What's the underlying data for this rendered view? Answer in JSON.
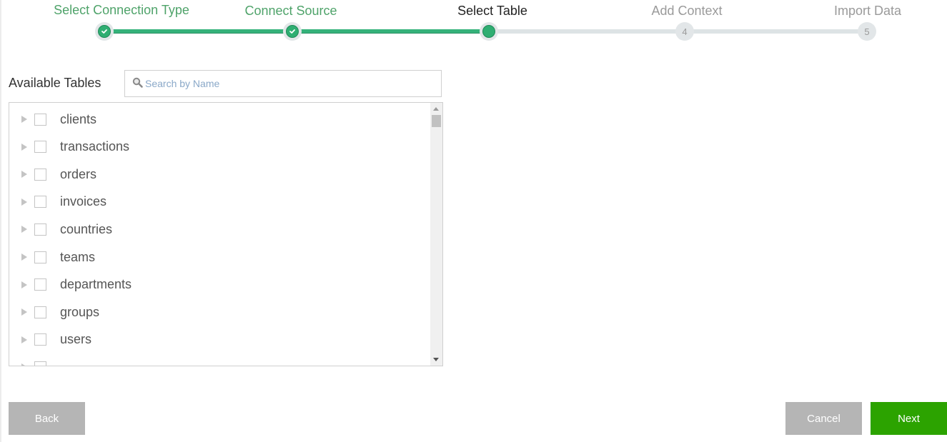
{
  "stepper": {
    "steps": [
      {
        "label": "Select Connection Type",
        "state": "done",
        "number": "1"
      },
      {
        "label": "Connect Source",
        "state": "done",
        "number": "2"
      },
      {
        "label": "Select Table",
        "state": "active",
        "number": "3"
      },
      {
        "label": "Add Context",
        "state": "todo",
        "number": "4"
      },
      {
        "label": "Import Data",
        "state": "todo",
        "number": "5"
      }
    ],
    "progress_fraction": 0.5
  },
  "tables": {
    "label": "Available Tables",
    "search_placeholder": "Search by Name",
    "search_value": "",
    "items": [
      {
        "name": "clients",
        "checked": false
      },
      {
        "name": "transactions",
        "checked": false
      },
      {
        "name": "orders",
        "checked": false
      },
      {
        "name": "invoices",
        "checked": false
      },
      {
        "name": "countries",
        "checked": false
      },
      {
        "name": "teams",
        "checked": false
      },
      {
        "name": "departments",
        "checked": false
      },
      {
        "name": "groups",
        "checked": false
      },
      {
        "name": "users",
        "checked": false
      },
      {
        "name": "",
        "checked": false
      }
    ]
  },
  "buttons": {
    "back": "Back",
    "cancel": "Cancel",
    "next": "Next"
  },
  "colors": {
    "accent_green": "#2fae72",
    "next_button": "#2ca300",
    "disabled_button": "#b5b5b5"
  }
}
